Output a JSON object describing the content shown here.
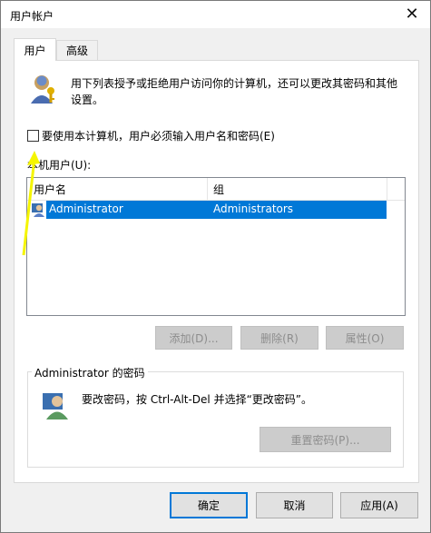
{
  "window": {
    "title": "用户帐户",
    "close_icon": "close-icon"
  },
  "tabs": [
    {
      "label": "用户",
      "active": true
    },
    {
      "label": "高级",
      "active": false
    }
  ],
  "description": "用下列表授予或拒绝用户访问你的计算机，还可以更改其密码和其他设置。",
  "require_login": {
    "label": "要使用本计算机，用户必须输入用户名和密码(E)",
    "checked": false
  },
  "users_list": {
    "label": "本机用户(U):",
    "columns": [
      "用户名",
      "组"
    ],
    "rows": [
      {
        "user": "Administrator",
        "group": "Administrators",
        "selected": true
      }
    ]
  },
  "list_buttons": {
    "add": "添加(D)...",
    "remove": "删除(R)",
    "properties": "属性(O)"
  },
  "password_group": {
    "title": "Administrator 的密码",
    "text": "要改密码，按 Ctrl-Alt-Del 并选择“更改密码”。",
    "reset_button": "重置密码(P)..."
  },
  "footer_buttons": {
    "ok": "确定",
    "cancel": "取消",
    "apply": "应用(A)"
  },
  "colors": {
    "selection": "#0078d7",
    "annotation_arrow": "#f5f500"
  }
}
